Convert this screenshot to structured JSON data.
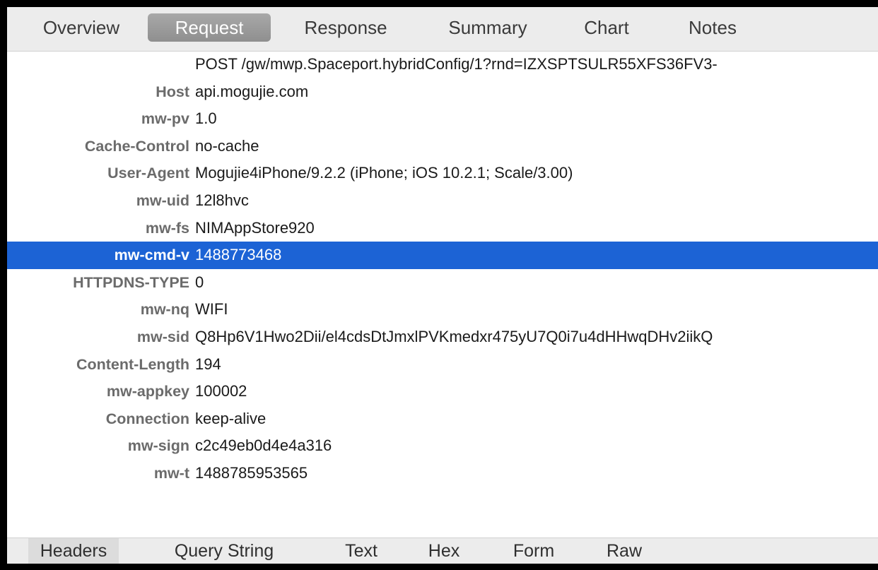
{
  "top_tabs": [
    {
      "label": "Overview",
      "active": false
    },
    {
      "label": "Request",
      "active": true
    },
    {
      "label": "Response",
      "active": false
    },
    {
      "label": "Summary",
      "active": false
    },
    {
      "label": "Chart",
      "active": false
    },
    {
      "label": "Notes",
      "active": false
    }
  ],
  "headers": [
    {
      "key": "",
      "value": "POST /gw/mwp.Spaceport.hybridConfig/1?rnd=IZXSPTSULR55XFS36FV3-"
    },
    {
      "key": "Host",
      "value": "api.mogujie.com"
    },
    {
      "key": "mw-pv",
      "value": "1.0"
    },
    {
      "key": "Cache-Control",
      "value": "no-cache"
    },
    {
      "key": "User-Agent",
      "value": "Mogujie4iPhone/9.2.2 (iPhone; iOS 10.2.1; Scale/3.00)"
    },
    {
      "key": "mw-uid",
      "value": "12l8hvc"
    },
    {
      "key": "mw-fs",
      "value": "NIMAppStore920"
    },
    {
      "key": "mw-cmd-v",
      "value": "1488773468",
      "selected": true
    },
    {
      "key": "HTTPDNS-TYPE",
      "value": "0"
    },
    {
      "key": "mw-nq",
      "value": "WIFI"
    },
    {
      "key": "mw-sid",
      "value": "Q8Hp6V1Hwo2Dii/el4cdsDtJmxlPVKmedxr475yU7Q0i7u4dHHwqDHv2iikQ"
    },
    {
      "key": "Content-Length",
      "value": "194"
    },
    {
      "key": "mw-appkey",
      "value": "100002"
    },
    {
      "key": "Connection",
      "value": "keep-alive"
    },
    {
      "key": "mw-sign",
      "value": "c2c49eb0d4e4a316"
    },
    {
      "key": "mw-t",
      "value": "1488785953565"
    }
  ],
  "bottom_tabs": [
    {
      "label": "Headers",
      "active": true
    },
    {
      "label": "Query String",
      "active": false
    },
    {
      "label": "Text",
      "active": false
    },
    {
      "label": "Hex",
      "active": false
    },
    {
      "label": "Form",
      "active": false
    },
    {
      "label": "Raw",
      "active": false
    }
  ],
  "colors": {
    "selection": "#1c63d5",
    "tab_active": "#9b9b9b",
    "toolbar_bg": "#ececec"
  }
}
